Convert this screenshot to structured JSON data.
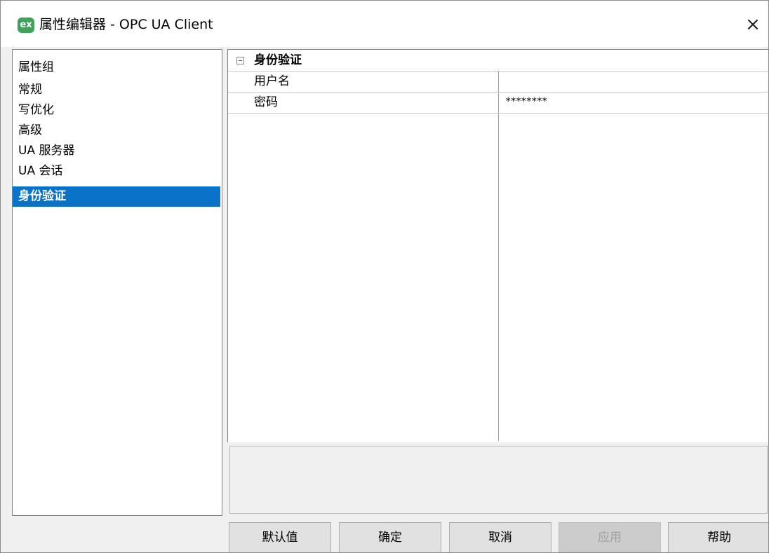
{
  "window": {
    "title": "属性编辑器 - OPC UA Client",
    "icon_text": "ex",
    "close_label": "×"
  },
  "groups": {
    "header": "属性组",
    "items": [
      {
        "label": "常规"
      },
      {
        "label": "写优化"
      },
      {
        "label": "高级"
      },
      {
        "label": "UA 服务器"
      },
      {
        "label": "UA 会话"
      },
      {
        "label": "身份验证",
        "selected": true
      }
    ]
  },
  "properties": {
    "category": "身份验证",
    "rows": [
      {
        "name": "用户名",
        "value": ""
      },
      {
        "name": "密码",
        "value": "********"
      }
    ]
  },
  "buttons": {
    "defaults": "默认值",
    "ok": "确定",
    "cancel": "取消",
    "apply": "应用",
    "help": "帮助"
  },
  "colors": {
    "selection": "#0a72c8",
    "icon": "#3da35a"
  }
}
